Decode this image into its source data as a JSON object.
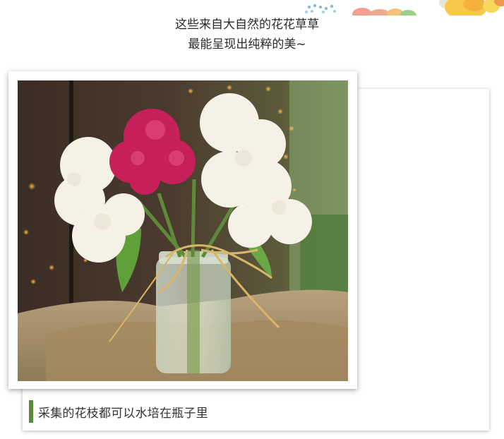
{
  "article": {
    "intro_line_1": "这些来自大自然的花花草草",
    "intro_line_2": "最能呈现出纯粹的美~",
    "caption": "采集的花枝都可以水培在瓶子里",
    "photo_subject": "hydrangea bouquet in a hanging mason jar tied with raffia",
    "accent_color": "#5a8a3c"
  }
}
